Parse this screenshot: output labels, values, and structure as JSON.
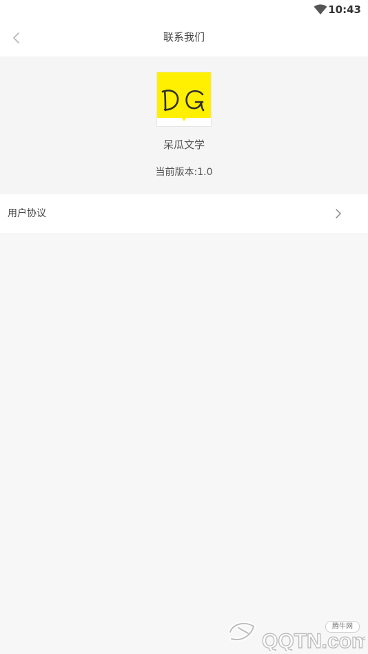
{
  "status_bar": {
    "time": "10:43",
    "wifi_icon": "wifi-icon"
  },
  "nav_bar": {
    "back_icon": "chevron-left-icon",
    "title": "联系我们"
  },
  "about": {
    "logo_text": "DG",
    "logo_color": "#ffef00",
    "app_name": "呆瓜文学",
    "version": "当前版本:1.0"
  },
  "menu": {
    "items": [
      {
        "label": "用户协议",
        "icon": "chevron-right-icon"
      }
    ]
  },
  "watermark": {
    "logo_text": "QQTN.com",
    "tag": "腾牛网"
  }
}
